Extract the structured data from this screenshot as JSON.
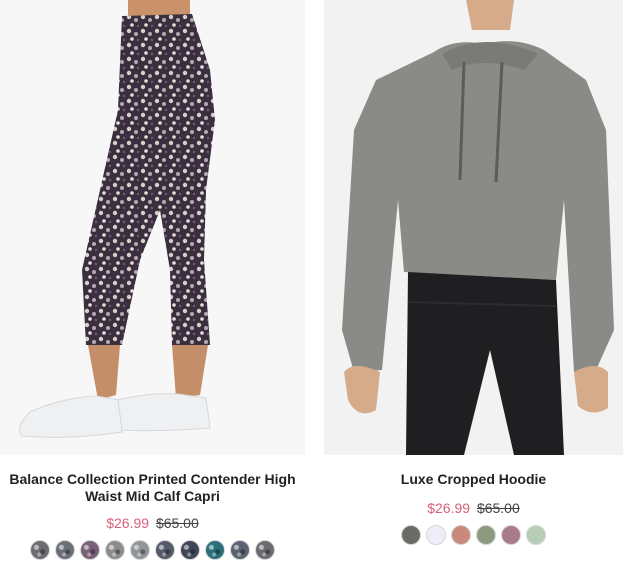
{
  "products": [
    {
      "title": "Balance Collection Printed Contender High Waist Mid Calf Capri",
      "sale_price": "$26.99",
      "original_price": "$65.00",
      "image_icon": "leggings-model-photo",
      "swatches": [
        "#6e6c72",
        "#6b7078",
        "#7a5f78",
        "#8d8d8f",
        "#8f9598",
        "#545a6a",
        "#3f4656",
        "#2b6f7a",
        "#5d6272",
        "#6c6c70"
      ]
    },
    {
      "title": "Luxe Cropped Hoodie",
      "sale_price": "$26.99",
      "original_price": "$65.00",
      "image_icon": "hoodie-model-photo",
      "swatches": [
        "#6a6b66",
        "#eeeef8",
        "#c98a7c",
        "#8d9a80",
        "#a97a87",
        "#b8cdb5"
      ]
    }
  ],
  "colors": {
    "sale": "#d9607a",
    "title": "#222222"
  }
}
